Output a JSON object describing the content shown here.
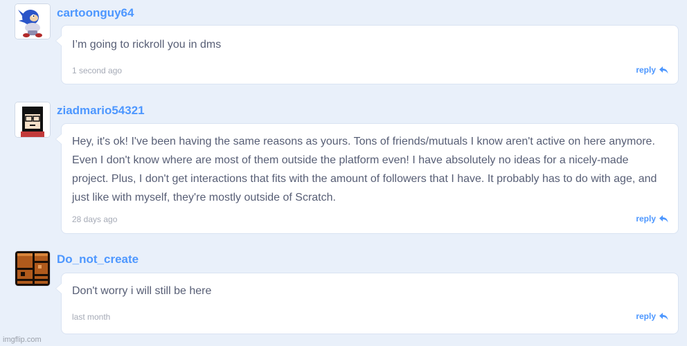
{
  "comments": [
    {
      "username": "cartoonguy64",
      "text": "I’m going to rickroll you in dms",
      "timestamp": "1 second ago",
      "reply_label": "reply"
    },
    {
      "username": "ziadmario54321",
      "text": "Hey, it's ok! I've been having the same reasons as yours. Tons of friends/mutuals I know aren't active on here anymore. Even I don't know where are most of them outside the platform even! I have absolutely no ideas for a nicely-made project. Plus, I don't get interactions that fits with the amount of followers that I have. It probably has to do with age, and just like with myself, they're mostly outside of Scratch.",
      "timestamp": "28 days ago",
      "reply_label": "reply"
    },
    {
      "username": "Do_not_create",
      "text": "Don't worry i will still be here",
      "timestamp": "last month",
      "reply_label": "reply"
    }
  ],
  "watermark": "imgflip.com",
  "colors": {
    "background": "#e9f0fa",
    "accent": "#4d97ff",
    "text": "#575e75",
    "muted": "#a5aab6"
  }
}
